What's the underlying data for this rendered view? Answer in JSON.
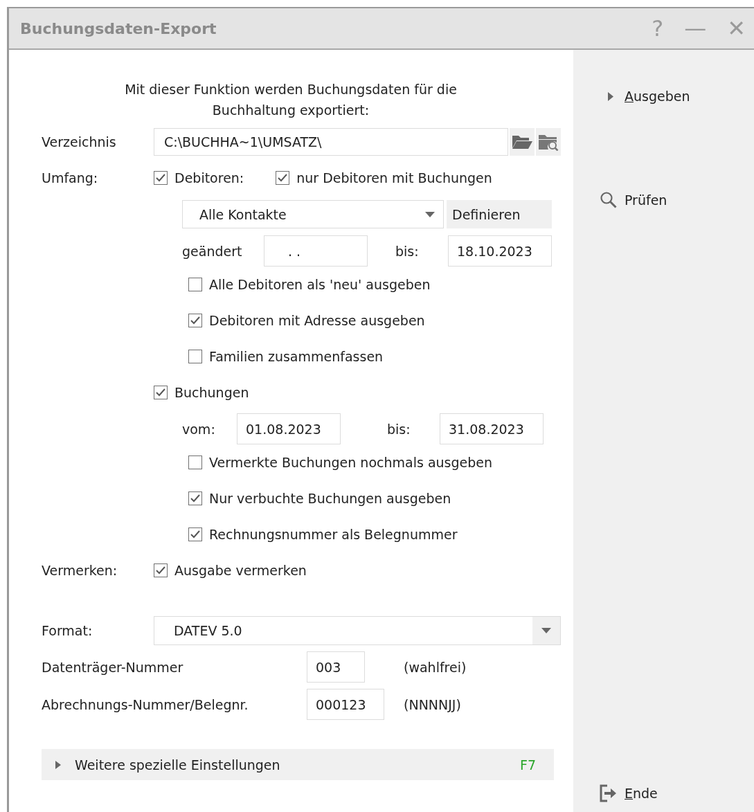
{
  "window": {
    "title": "Buchungsdaten-Export",
    "controls": [
      "?",
      "—",
      "✕"
    ]
  },
  "intro": "Mit dieser Funktion werden Buchungsdaten für die Buchhaltung exportiert:",
  "directory": {
    "label": "Verzeichnis",
    "value": "C:\\BUCHHA~1\\UMSATZ\\"
  },
  "scope": {
    "label": "Umfang:",
    "debtors": {
      "label": "Debitoren:",
      "checked": true
    },
    "only_with_bookings": {
      "label": "nur Debitoren mit Buchungen",
      "checked": true
    },
    "contacts": {
      "value": "Alle Kontakte"
    },
    "define_button": "Definieren",
    "changed": {
      "label": "geändert",
      "value": ". .",
      "to_label": "bis:",
      "to_value": "18.10.2023"
    },
    "debtor_options": [
      {
        "label": "Alle Debitoren als 'neu' ausgeben",
        "checked": false
      },
      {
        "label": "Debitoren mit Adresse ausgeben",
        "checked": true
      },
      {
        "label": "Familien zusammenfassen",
        "checked": false
      }
    ],
    "bookings": {
      "label": "Buchungen",
      "checked": true
    },
    "period": {
      "label": "vom:",
      "value": "01.08.2023",
      "to_label": "bis:",
      "to_value": "31.08.2023"
    },
    "booking_options": [
      {
        "label": "Vermerkte Buchungen nochmals ausgeben",
        "checked": false
      },
      {
        "label": "Nur verbuchte Buchungen ausgeben",
        "checked": true
      },
      {
        "label": "Rechnungsnummer als Belegnummer",
        "checked": true
      }
    ]
  },
  "mark": {
    "label": "Vermerken:",
    "option": {
      "label": "Ausgabe vermerken",
      "checked": true
    }
  },
  "format": {
    "label": "Format:",
    "value": "DATEV 5.0"
  },
  "numbers": [
    {
      "label": "Datenträger-Nummer",
      "value": "003",
      "hint": "(wahlfrei)"
    },
    {
      "label": "Abrechnungs-Nummer/Belegnr.",
      "value": "000123",
      "hint": "(NNNNJJ)"
    }
  ],
  "more_settings": {
    "label": "Weitere spezielle Einstellungen",
    "shortcut": "F7",
    "expanded": false
  },
  "actions": [
    {
      "label": "Ausgeben",
      "kind": "run",
      "underline_first": true
    },
    {
      "label": "Prüfen",
      "kind": "check",
      "underline_first": false
    },
    {
      "label": "Ende",
      "kind": "exit",
      "underline_first": true
    }
  ]
}
